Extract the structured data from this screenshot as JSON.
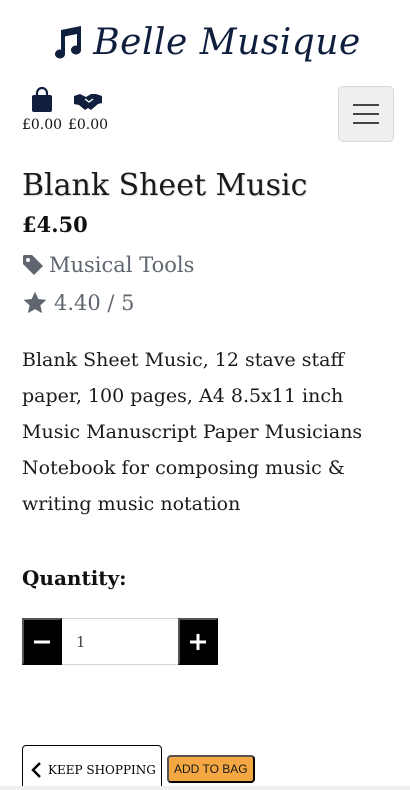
{
  "brand": {
    "name": "Belle Musique",
    "icon": "music-note-icon"
  },
  "nav": {
    "bag": {
      "icon": "shopping-bag-icon",
      "amount": "£0.00"
    },
    "deals": {
      "icon": "handshake-icon",
      "amount": "£0.00"
    },
    "menu_icon": "hamburger-menu-icon"
  },
  "product": {
    "name": "Blank Sheet Music",
    "price": "£4.50",
    "category": "Musical Tools",
    "category_icon": "tag-icon",
    "rating": "4.40 / 5",
    "rating_icon": "star-icon",
    "description": "Blank Sheet Music, 12 stave staff paper, 100 pages, A4 8.5x11 inch Music Manuscript Paper Musicians Notebook for composing music & writing music notation"
  },
  "quantity": {
    "label": "Quantity:",
    "value": "1"
  },
  "actions": {
    "keep_shopping": "Keep Shopping",
    "add_to_bag": "Add to Bag"
  },
  "colors": {
    "brand": "#0f1f3d",
    "accent": "#f4a742",
    "muted": "#5f6670"
  }
}
